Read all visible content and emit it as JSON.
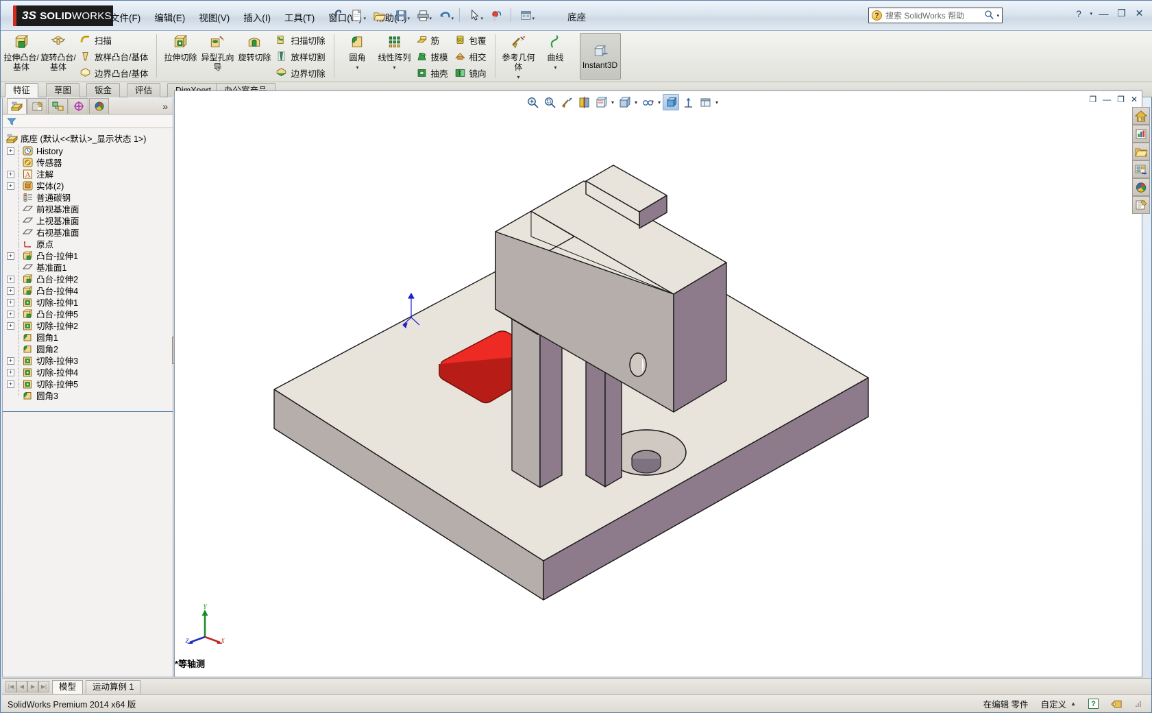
{
  "app": {
    "brand_ds": "3S",
    "brand_solid": "SOLID",
    "brand_works": "WORKS",
    "document_title": "底座",
    "version_status": "SolidWorks Premium 2014 x64 版",
    "accent_red": "#d42b1e",
    "accent_blue": "#2d5f9e"
  },
  "menubar": {
    "items": [
      {
        "label": "文件(F)",
        "name": "menu-file"
      },
      {
        "label": "编辑(E)",
        "name": "menu-edit"
      },
      {
        "label": "视图(V)",
        "name": "menu-view"
      },
      {
        "label": "插入(I)",
        "name": "menu-insert"
      },
      {
        "label": "工具(T)",
        "name": "menu-tools"
      },
      {
        "label": "窗口(W)",
        "name": "menu-window"
      },
      {
        "label": "帮助(H)",
        "name": "menu-help"
      }
    ]
  },
  "quick_access": {
    "buttons": [
      {
        "name": "new-document-icon",
        "title": "新建"
      },
      {
        "name": "open-document-icon",
        "title": "打开"
      },
      {
        "name": "save-icon",
        "title": "保存"
      },
      {
        "name": "print-icon",
        "title": "打印"
      },
      {
        "name": "undo-icon",
        "title": "撤消"
      },
      {
        "name": "select-arrow-icon",
        "title": "选择"
      },
      {
        "name": "rebuild-icon",
        "title": "重建模型"
      },
      {
        "name": "options-gear-icon",
        "title": "选项"
      }
    ]
  },
  "search": {
    "placeholder": "搜索 SolidWorks 帮助",
    "magnifier_icon": "search-icon",
    "dropdown_icon": "chevron-down-icon"
  },
  "window_controls": {
    "help": "?",
    "minimize": "—",
    "restore": "❐",
    "close": "✕"
  },
  "ribbon": {
    "groups": [
      {
        "name": "boss-group",
        "big": [
          {
            "label": "拉伸凸台/基体",
            "name": "extruded-boss-base-button",
            "icon": "extrude-boss-icon"
          },
          {
            "label": "旋转凸台/基体",
            "name": "revolved-boss-base-button",
            "icon": "revolve-boss-icon"
          }
        ],
        "small": [
          {
            "label": "扫描",
            "name": "swept-boss-button",
            "icon": "sweep-icon"
          },
          {
            "label": "放样凸台/基体",
            "name": "lofted-boss-button",
            "icon": "loft-icon"
          },
          {
            "label": "边界凸台/基体",
            "name": "boundary-boss-button",
            "icon": "boundary-icon"
          }
        ]
      },
      {
        "name": "cut-group",
        "big": [
          {
            "label": "拉伸切除",
            "name": "extruded-cut-button",
            "icon": "extrude-cut-icon"
          },
          {
            "label": "异型孔向导",
            "name": "hole-wizard-button",
            "icon": "hole-wizard-icon"
          },
          {
            "label": "旋转切除",
            "name": "revolved-cut-button",
            "icon": "revolve-cut-icon"
          }
        ],
        "small": [
          {
            "label": "扫描切除",
            "name": "swept-cut-button",
            "icon": "sweep-cut-icon"
          },
          {
            "label": "放样切割",
            "name": "lofted-cut-button",
            "icon": "loft-cut-icon"
          },
          {
            "label": "边界切除",
            "name": "boundary-cut-button",
            "icon": "boundary-cut-icon"
          }
        ]
      },
      {
        "name": "fillet-pattern-group",
        "big": [
          {
            "label": "圆角",
            "name": "fillet-button",
            "icon": "fillet-icon",
            "has_dropdown": true
          },
          {
            "label": "线性阵列",
            "name": "linear-pattern-button",
            "icon": "linear-pattern-icon",
            "has_dropdown": true
          }
        ],
        "small": [
          {
            "label": "筋",
            "name": "rib-button",
            "icon": "rib-icon"
          },
          {
            "label": "拔模",
            "name": "draft-button",
            "icon": "draft-icon"
          },
          {
            "label": "抽壳",
            "name": "shell-button",
            "icon": "shell-icon"
          }
        ],
        "small2": [
          {
            "label": "包覆",
            "name": "wrap-button",
            "icon": "wrap-icon"
          },
          {
            "label": "相交",
            "name": "intersect-button",
            "icon": "intersect-icon"
          },
          {
            "label": "镜向",
            "name": "mirror-button",
            "icon": "mirror-icon"
          }
        ]
      },
      {
        "name": "reference-group",
        "big": [
          {
            "label": "参考几何体",
            "name": "reference-geometry-button",
            "icon": "reference-geometry-icon",
            "has_dropdown": true
          },
          {
            "label": "曲线",
            "name": "curves-button",
            "icon": "curve-icon",
            "has_dropdown": true
          }
        ]
      },
      {
        "name": "instant3d-group",
        "toggle": {
          "label": "Instant3D",
          "name": "instant3d-toggle",
          "active": true
        }
      }
    ]
  },
  "command_tabs": {
    "items": [
      {
        "label": "特征",
        "name": "tab-features",
        "active": true
      },
      {
        "label": "草图",
        "name": "tab-sketch",
        "active": false
      },
      {
        "label": "钣金",
        "name": "tab-sheetmetal",
        "active": false
      },
      {
        "label": "评估",
        "name": "tab-evaluate",
        "active": false
      },
      {
        "label": "DimXpert",
        "name": "tab-dimxpert",
        "active": false
      },
      {
        "label": "办公室产品",
        "name": "tab-office-products",
        "active": false
      }
    ]
  },
  "feature_manager": {
    "tabs": [
      {
        "name": "feature-manager-tab",
        "icon": "feature-tree-icon",
        "active": true
      },
      {
        "name": "property-manager-tab",
        "icon": "property-manager-icon",
        "active": false
      },
      {
        "name": "configuration-manager-tab",
        "icon": "configuration-manager-icon",
        "active": false
      },
      {
        "name": "dimxpert-manager-tab",
        "icon": "dimxpert-manager-icon",
        "active": false
      },
      {
        "name": "display-manager-tab",
        "icon": "display-manager-icon",
        "active": false
      }
    ],
    "more_icon": "chevron-double-right-icon",
    "filter_icon": "filter-funnel-icon",
    "root": {
      "label": "底座  (默认<<默认>_显示状态 1>)",
      "icon": "part-icon"
    },
    "nodes": [
      {
        "label": "History",
        "icon": "history-icon",
        "expandable": true
      },
      {
        "label": "传感器",
        "icon": "sensors-icon",
        "expandable": false
      },
      {
        "label": "注解",
        "icon": "annotations-icon",
        "expandable": true
      },
      {
        "label": "实体(2)",
        "icon": "solid-bodies-icon",
        "expandable": true
      },
      {
        "label": "普通碳钢",
        "icon": "material-icon",
        "expandable": false
      },
      {
        "label": "前视基准面",
        "icon": "plane-icon",
        "expandable": false
      },
      {
        "label": "上视基准面",
        "icon": "plane-icon",
        "expandable": false
      },
      {
        "label": "右视基准面",
        "icon": "plane-icon",
        "expandable": false
      },
      {
        "label": "原点",
        "icon": "origin-icon",
        "expandable": false
      },
      {
        "label": "凸台-拉伸1",
        "icon": "boss-extrude-icon",
        "expandable": true
      },
      {
        "label": "基准面1",
        "icon": "plane-icon",
        "expandable": false
      },
      {
        "label": "凸台-拉伸2",
        "icon": "boss-extrude-icon",
        "expandable": true
      },
      {
        "label": "凸台-拉伸4",
        "icon": "boss-extrude-icon",
        "expandable": true
      },
      {
        "label": "切除-拉伸1",
        "icon": "cut-extrude-icon",
        "expandable": true
      },
      {
        "label": "凸台-拉伸5",
        "icon": "boss-extrude-icon",
        "expandable": true
      },
      {
        "label": "切除-拉伸2",
        "icon": "cut-extrude-icon",
        "expandable": true
      },
      {
        "label": "圆角1",
        "icon": "fillet-feature-icon",
        "expandable": false
      },
      {
        "label": "圆角2",
        "icon": "fillet-feature-icon",
        "expandable": false
      },
      {
        "label": "切除-拉伸3",
        "icon": "cut-extrude-icon",
        "expandable": true
      },
      {
        "label": "切除-拉伸4",
        "icon": "cut-extrude-icon",
        "expandable": true
      },
      {
        "label": "切除-拉伸5",
        "icon": "cut-extrude-icon",
        "expandable": true
      },
      {
        "label": "圆角3",
        "icon": "fillet-feature-icon",
        "expandable": false
      }
    ]
  },
  "view_toolbar": {
    "buttons": [
      {
        "name": "zoom-to-fit-icon",
        "selected": false
      },
      {
        "name": "zoom-to-area-icon",
        "selected": false
      },
      {
        "name": "previous-view-icon",
        "selected": false
      },
      {
        "name": "section-view-icon",
        "selected": false
      },
      {
        "name": "view-orientation-icon",
        "selected": false,
        "dropdown": true
      },
      {
        "name": "display-style-icon",
        "selected": false,
        "dropdown": true
      },
      {
        "name": "hide-show-items-icon",
        "selected": false,
        "dropdown": true
      },
      {
        "name": "apply-scene-icon",
        "selected": true
      },
      {
        "name": "view-settings-icon",
        "selected": false
      },
      {
        "name": "display-panes-icon",
        "selected": false,
        "dropdown": true
      }
    ]
  },
  "graphics_window_controls": {
    "restore_small": "❐",
    "minimize": "—",
    "maximize": "❐",
    "close": "✕"
  },
  "task_pane": {
    "buttons": [
      {
        "name": "sw-resources-home-icon"
      },
      {
        "name": "design-portfolio-chart-icon"
      },
      {
        "name": "file-explorer-folder-icon"
      },
      {
        "name": "design-library-icon"
      },
      {
        "name": "appearances-scenes-icon"
      },
      {
        "name": "custom-properties-icon"
      }
    ]
  },
  "viewport": {
    "orientation_label": "*等轴测",
    "triad": {
      "x": "X",
      "y": "Y",
      "z": "Z"
    },
    "model": {
      "name": "底座",
      "face_top_color": "#e8e4dc",
      "face_side_color": "#b5aeaa",
      "face_dark_color": "#8d7b8b",
      "highlight_color": "#ee2a24",
      "edge_color": "#1a1a1a"
    }
  },
  "document_tabs": {
    "nav": [
      "|◀",
      "◀",
      "▶",
      "▶|"
    ],
    "tabs": [
      {
        "label": "模型",
        "name": "doc-tab-model",
        "active": true
      },
      {
        "label": "运动算例 1",
        "name": "doc-tab-motion-study-1",
        "active": false
      }
    ]
  },
  "status_bar": {
    "left": "SolidWorks Premium 2014 x64 版",
    "editing": "在编辑 零件",
    "custom": "自定义",
    "custom_caret": "▲",
    "help_badge": "?",
    "tag_icon": "tag-icon",
    "grip_icon": "resize-grip-icon"
  }
}
